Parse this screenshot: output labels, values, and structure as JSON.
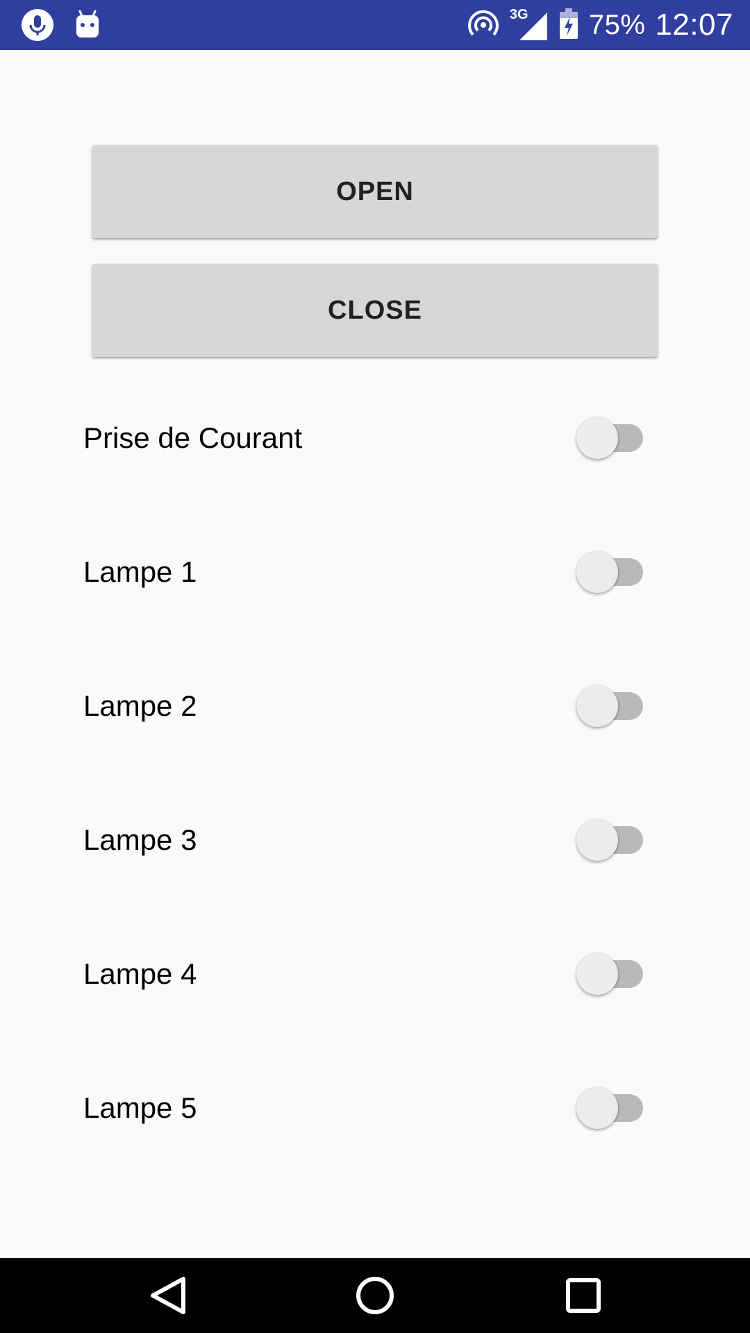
{
  "status_bar": {
    "left_icons": [
      "microphone-icon",
      "android-icon"
    ],
    "network_type": "3G",
    "battery_percent": "75%",
    "time": "12:07",
    "background_color": "#303f9f"
  },
  "buttons": {
    "open_label": "OPEN",
    "close_label": "CLOSE"
  },
  "switches": [
    {
      "label": "Prise de Courant",
      "checked": false
    },
    {
      "label": "Lampe 1",
      "checked": false
    },
    {
      "label": "Lampe 2",
      "checked": false
    },
    {
      "label": "Lampe 3",
      "checked": false
    },
    {
      "label": "Lampe 4",
      "checked": false
    },
    {
      "label": "Lampe 5",
      "checked": false
    }
  ],
  "nav_bar": {
    "icons": [
      "back-icon",
      "home-icon",
      "recents-icon"
    ]
  }
}
